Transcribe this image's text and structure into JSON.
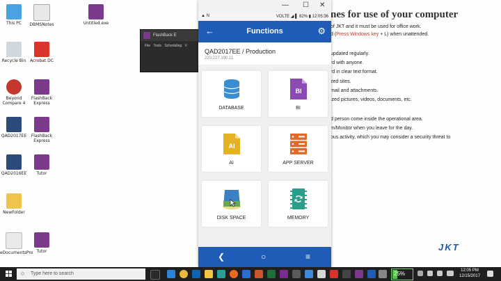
{
  "desktop_icons": [
    {
      "label": "This PC",
      "icon": "computer-icon"
    },
    {
      "label": "DBMSNotes",
      "icon": "document-icon"
    },
    {
      "label": "Untitled.exe",
      "icon": "flashback-icon"
    },
    {
      "label": "Recycle Bin",
      "icon": "recycle-bin-icon"
    },
    {
      "label": "Acrobat DC",
      "icon": "pdf-icon"
    },
    {
      "label": "Beyond Compare 4",
      "icon": "compare-icon"
    },
    {
      "label": "FlashBack Express",
      "icon": "flashback-icon"
    },
    {
      "label": "QAD2017EE",
      "icon": "app-icon"
    },
    {
      "label": "FlashBack Express",
      "icon": "flashback-icon"
    },
    {
      "label": "QAD2016EE",
      "icon": "app-icon"
    },
    {
      "label": "Tutor",
      "icon": "flashback-icon"
    },
    {
      "label": "NewFolder",
      "icon": "folder-icon"
    },
    {
      "label": "eDocumentsPro",
      "icon": "shortcut-icon"
    },
    {
      "label": "Tutor",
      "icon": "flashback-icon"
    }
  ],
  "flashback": {
    "title": "FlashBack E",
    "menu": [
      "File",
      "Tools",
      "Scheduling",
      "V"
    ]
  },
  "doc": {
    "title": "nes for use of your computer",
    "lines": [
      {
        "pre": "of JKT and it must be used for office work.",
        "hl": "",
        "post": ""
      },
      {
        "pre": "d (",
        "hl": "Press Windows key",
        "post": " + L) when unattended."
      },
      {
        "pre": "updated regularly.",
        "hl": "",
        "post": ""
      },
      {
        "pre": "rd with anyone.",
        "hl": "",
        "post": ""
      },
      {
        "pre": "rd in clear text format.",
        "hl": "",
        "post": ""
      },
      {
        "pre": "zed sites.",
        "hl": "",
        "post": ""
      },
      {
        "pre": " mail and attachments.",
        "hl": "",
        "post": ""
      },
      {
        "pre": "ized pictures, videos, documents, etc.",
        "hl": "",
        "post": ""
      },
      {
        "pre": "d person come inside the operational area.",
        "hl": "",
        "post": ""
      },
      {
        "pre": "m/Monitor when you leave for the day.",
        "hl": "",
        "post": ""
      },
      {
        "pre": "ous activity, which you may consider a security threat to",
        "hl": "",
        "post": ""
      }
    ],
    "logo": "JKT"
  },
  "emulator": {
    "window_controls": [
      "—",
      "☐",
      "✕"
    ],
    "status_left": "▲ N",
    "status_right": "VOLTE ◢ ▌ 82% ▮ 12:05:36",
    "appbar": {
      "title": "Functions",
      "back": "←",
      "settings": "⚙"
    },
    "environment": {
      "name": "QAD2017EE / Production",
      "ip": "220.227.190.11"
    },
    "tiles": [
      {
        "label": "DATABASE",
        "icon": "database-icon"
      },
      {
        "label": "BI",
        "icon": "bi-document-icon"
      },
      {
        "label": "AI",
        "icon": "ai-document-icon"
      },
      {
        "label": "APP SERVER",
        "icon": "server-icon"
      },
      {
        "label": "DISK SPACE",
        "icon": "disk-icon"
      },
      {
        "label": "MEMORY",
        "icon": "memory-chip-icon"
      }
    ],
    "navbar": {
      "back": "❮",
      "home": "○",
      "menu": "≡"
    }
  },
  "taskbar": {
    "search_placeholder": "Type here to search",
    "battery": "25%",
    "battery_level": 0.25,
    "time": "12:05 PM",
    "date": "12/15/2017"
  },
  "colors": {
    "accent": "#1e5cb8",
    "tile_db": "#3b8dd1",
    "tile_bi": "#8c4bb4",
    "tile_ai": "#e5b224",
    "tile_server": "#e06a2c",
    "tile_mem": "#2a9e8a"
  }
}
